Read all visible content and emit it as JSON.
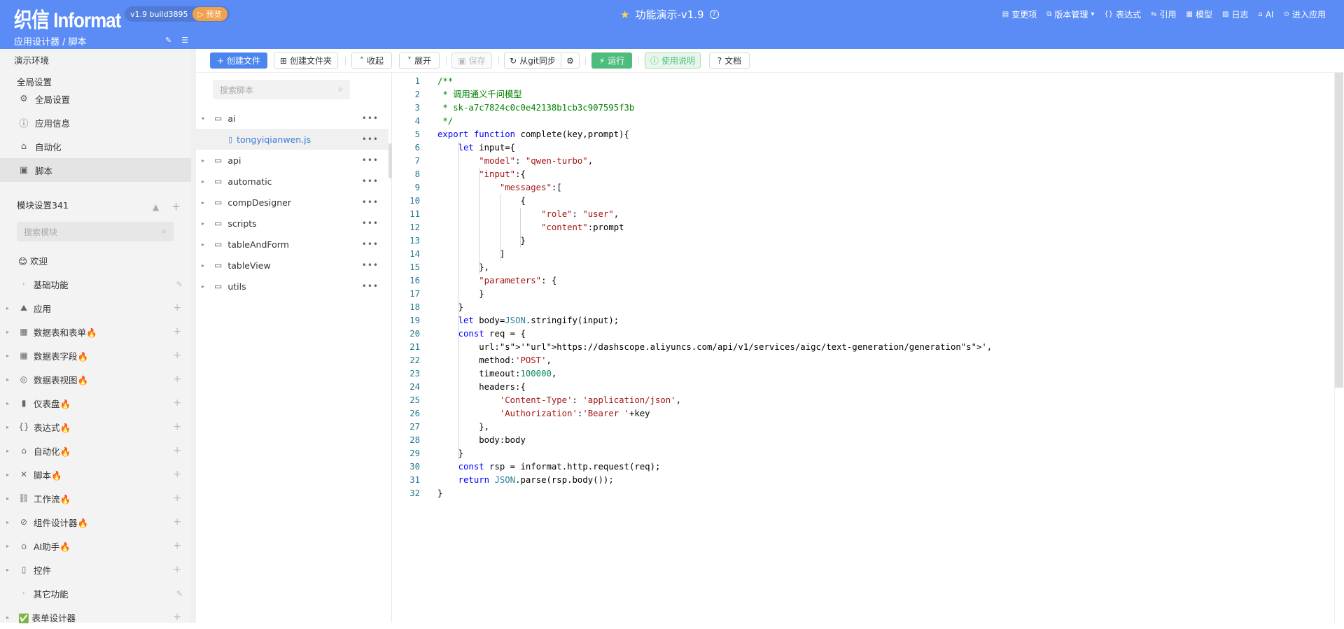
{
  "header": {
    "logo": "织信 Informat",
    "version": "v1.9 build3895",
    "preview_badge": "▷ 预览",
    "title": "功能演示-v1.9",
    "menu": [
      {
        "icon": "list-icon",
        "label": "变更项"
      },
      {
        "icon": "version-icon",
        "label": "版本管理"
      },
      {
        "icon": "braces-icon",
        "label": "表达式"
      },
      {
        "icon": "link-icon",
        "label": "引用"
      },
      {
        "icon": "model-icon",
        "label": "模型"
      },
      {
        "icon": "log-icon",
        "label": "日志"
      },
      {
        "icon": "ai-icon",
        "label": "AI"
      },
      {
        "icon": "enter-icon",
        "label": "进入应用"
      }
    ],
    "breadcrumb": "应用设计器 / 脚本"
  },
  "sidebar": {
    "env_label": "演示环境",
    "global_section": "全局设置",
    "global_items": [
      {
        "icon": "gear-icon",
        "label": "全局设置"
      },
      {
        "icon": "info-icon",
        "label": "应用信息"
      },
      {
        "icon": "robot-icon",
        "label": "自动化"
      },
      {
        "icon": "script-icon",
        "label": "脚本"
      }
    ],
    "module_section": "模块设置341",
    "module_search_placeholder": "搜索模块",
    "welcome": "😊 欢迎",
    "basic_features": "基础功能",
    "modules": [
      {
        "icon": "mountain-icon",
        "label": "应用"
      },
      {
        "icon": "table-icon",
        "label": "数据表和表单🔥"
      },
      {
        "icon": "table-icon",
        "label": "数据表字段🔥"
      },
      {
        "icon": "view-icon",
        "label": "数据表视图🔥"
      },
      {
        "icon": "chart-icon",
        "label": "仪表盘🔥"
      },
      {
        "icon": "braces-icon",
        "label": "表达式🔥"
      },
      {
        "icon": "robot-icon",
        "label": "自动化🔥"
      },
      {
        "icon": "script-icon",
        "label": "脚本🔥"
      },
      {
        "icon": "workflow-icon",
        "label": "工作流🔥"
      },
      {
        "icon": "compass-icon",
        "label": "组件设计器🔥"
      },
      {
        "icon": "robot-icon",
        "label": "AI助手🔥"
      },
      {
        "icon": "control-icon",
        "label": "控件"
      }
    ],
    "other_features": "其它功能",
    "form_designer": "✅ 表单设计器"
  },
  "toolbar": {
    "create_file": "+ 创建文件",
    "create_folder": "创建文件夹",
    "collapse": "收起",
    "expand": "展开",
    "save": "保存",
    "git_sync": "从git同步",
    "run": "运行",
    "instructions": "使用说明",
    "docs": "文档"
  },
  "tree": {
    "search_placeholder": "搜索脚本",
    "items": [
      {
        "type": "folder",
        "name": "ai",
        "expanded": true
      },
      {
        "type": "file",
        "name": "tongyiqianwen.js",
        "selected": true
      },
      {
        "type": "folder",
        "name": "api"
      },
      {
        "type": "folder",
        "name": "automatic"
      },
      {
        "type": "folder",
        "name": "compDesigner"
      },
      {
        "type": "folder",
        "name": "scripts"
      },
      {
        "type": "folder",
        "name": "tableAndForm"
      },
      {
        "type": "folder",
        "name": "tableView"
      },
      {
        "type": "folder",
        "name": "utils"
      }
    ]
  },
  "editor": {
    "lines": [
      "/**",
      " * 调用通义千问模型",
      " * sk-a7c7824c0c0e42138b1cb3c907595f3b",
      " */",
      "export function complete(key,prompt){",
      "    let input={",
      "        \"model\": \"qwen-turbo\",",
      "        \"input\":{",
      "            \"messages\":[",
      "                {",
      "                    \"role\": \"user\",",
      "                    \"content\":prompt",
      "                }",
      "            ]",
      "        },",
      "        \"parameters\": {",
      "        }",
      "    }",
      "    let body=JSON.stringify(input);",
      "    const req = {",
      "        url:'https://dashscope.aliyuncs.com/api/v1/services/aigc/text-generation/generation',",
      "        method:'POST',",
      "        timeout:100000,",
      "        headers:{",
      "            'Content-Type': 'application/json',",
      "            'Authorization':'Bearer '+key",
      "        },",
      "        body:body",
      "    }",
      "    const rsp = informat.http.request(req);",
      "    return JSON.parse(rsp.body());",
      "}"
    ]
  },
  "colors": {
    "header": "#5b8cf5",
    "primary": "#4d85ee",
    "run": "#4ebc7c",
    "preview": "#f0a24a"
  }
}
